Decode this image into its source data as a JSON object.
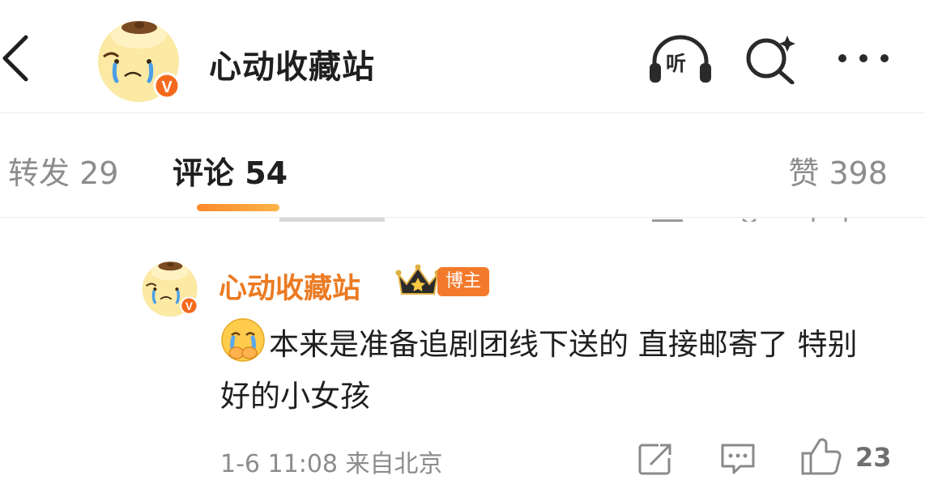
{
  "header": {
    "title": "心动收藏站",
    "back_icon": "chevron-left-icon",
    "listen_label": "听",
    "verified_mark": "V",
    "colors": {
      "verified": "#f46a1d",
      "accent": "#ff8a2c"
    }
  },
  "tabs": [
    {
      "label": "转发 29",
      "active": false
    },
    {
      "label": "评论 54",
      "active": true
    },
    {
      "label": "赞 398",
      "active": false
    }
  ],
  "comment": {
    "author": "心动收藏站",
    "role_badge": "博主",
    "text": "本来是准备追剧团线下送的 直接邮寄了 特别好的小女孩",
    "time": "1-6 11:08",
    "location": "来自北京",
    "like_count": "23",
    "name_color": "#eb7a22"
  }
}
